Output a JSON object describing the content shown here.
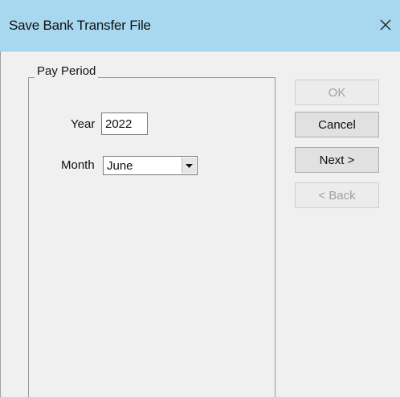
{
  "window": {
    "title": "Save Bank Transfer File",
    "close_glyph": "✕",
    "titlebar_color": "#a8d8f0"
  },
  "pay_period": {
    "group_label": "Pay Period",
    "year_label": "Year",
    "year_value": "2022",
    "month_label": "Month",
    "month_value": "June"
  },
  "buttons": {
    "ok_label": "OK",
    "ok_enabled": false,
    "cancel_label": "Cancel",
    "cancel_enabled": true,
    "next_label": "Next >",
    "next_enabled": true,
    "back_label": "< Back",
    "back_enabled": false
  },
  "icons": {
    "close": "close-icon",
    "dropdown": "chevron-down-icon"
  }
}
